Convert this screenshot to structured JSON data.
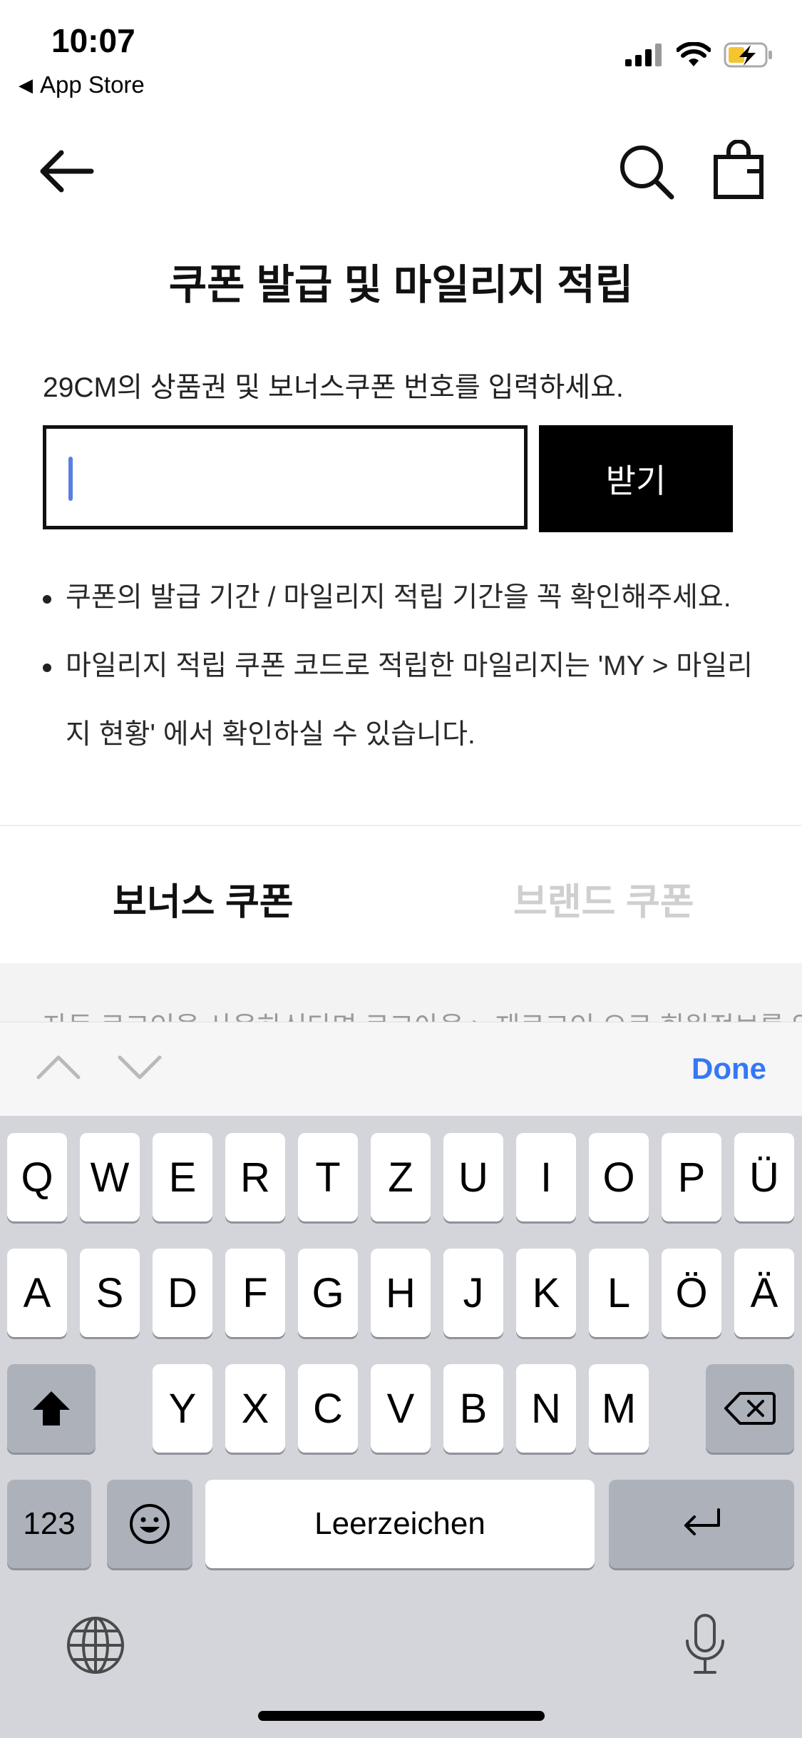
{
  "status_bar": {
    "time": "10:07",
    "back_label": "App Store"
  },
  "nav": {
    "back_icon": "arrow-left-icon",
    "search_icon": "search-icon",
    "bag_icon": "shopping-bag-icon"
  },
  "page": {
    "title": "쿠폰 발급 및 마일리지 적립",
    "instruction": "29CM의 상품권 및 보너스쿠폰 번호를 입력하세요.",
    "input": {
      "value": "",
      "placeholder": ""
    },
    "receive_button": "받기",
    "notes": [
      "쿠폰의 발급 기간 / 마일리지 적립 기간을 꼭 확인해주세요.",
      "마일리지 적립 쿠폰 코드로 적립한 마일리지는 'MY > 마일리지 현황' 에서 확인하실 수 있습니다."
    ],
    "tabs": [
      {
        "label": "보너스 쿠폰",
        "active": true
      },
      {
        "label": "브랜드 쿠폰",
        "active": false
      }
    ],
    "cut_off_text": "자동 로그인을 사용하신다면 로그아웃 > 재로그인 으로 회원정보를 업데"
  },
  "keyboard": {
    "done_label": "Done",
    "row1": [
      "Q",
      "W",
      "E",
      "R",
      "T",
      "Z",
      "U",
      "I",
      "O",
      "P",
      "Ü"
    ],
    "row2": [
      "A",
      "S",
      "D",
      "F",
      "G",
      "H",
      "J",
      "K",
      "L",
      "Ö",
      "Ä"
    ],
    "row3": [
      "Y",
      "X",
      "C",
      "V",
      "B",
      "N",
      "M"
    ],
    "numbers_label": "123",
    "space_label": "Leerzeichen",
    "icons": [
      "shift-icon",
      "backspace-icon",
      "emoji-icon",
      "return-icon",
      "globe-icon",
      "microphone-icon",
      "chevron-up-icon",
      "chevron-down-icon"
    ]
  },
  "colors": {
    "accent": "#3478f6",
    "caret": "#5b7fe0",
    "button_bg": "#000000",
    "tab_inactive": "#cfcfcf",
    "keyboard_bg": "#d3d5db",
    "key_fn": "#adb1ba"
  }
}
